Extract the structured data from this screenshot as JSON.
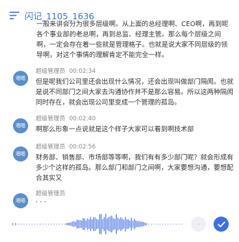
{
  "header": {
    "title": "闪记_1105_1636",
    "menu_icon": "menu-icon"
  },
  "transcript": {
    "first_text": "一般来讲会分为很多层级啊。从上面的总经理啊、CEO啊，再到呢各个事业部的老总啊，再到总监、经理主管。那么每个层级之间啊，一定会存在着一些就是管理格子。也就是说大家不同层级的领导啊，对这个事情的理解肯定不能完全一样。",
    "entries": [
      {
        "avatar": "嗯嗯",
        "speaker": "超级管理员",
        "time": "00:02:34",
        "text": "但是呢我们公司里还会出现什么情况，还会出现叫做部门隔阂。也就是说不同部门之间大家去沟通协作并不是那么容易。所以这两种隔阂同时存在，就会出现公司里变成一个管理的孤岛。"
      },
      {
        "avatar": "嗯嗯",
        "speaker": "超级管理员",
        "time": "00:02:40",
        "text": "啊那么形象一点说就是这个样子大家可以看到啊技术部"
      },
      {
        "avatar": "嗯嗯",
        "speaker": "超级管理员",
        "time": "00:02:56",
        "text": "财务部、销售部、市场部等等啊，我们有有多少部门呢？就会形成有多少个这样的孤岛。那么部门和部门之间啊，大家要想沟通，要想配合其实又"
      },
      {
        "avatar": "嗯嗯",
        "speaker": "超级管理员",
        "time": "",
        "text": "· · ·"
      }
    ]
  },
  "player": {
    "waveform_icon": "waveform-icon",
    "pause_icon": "pause-icon",
    "done_icon": "check-icon",
    "accent": "#3d6fe0",
    "wave_color": "#5b7fe6"
  }
}
